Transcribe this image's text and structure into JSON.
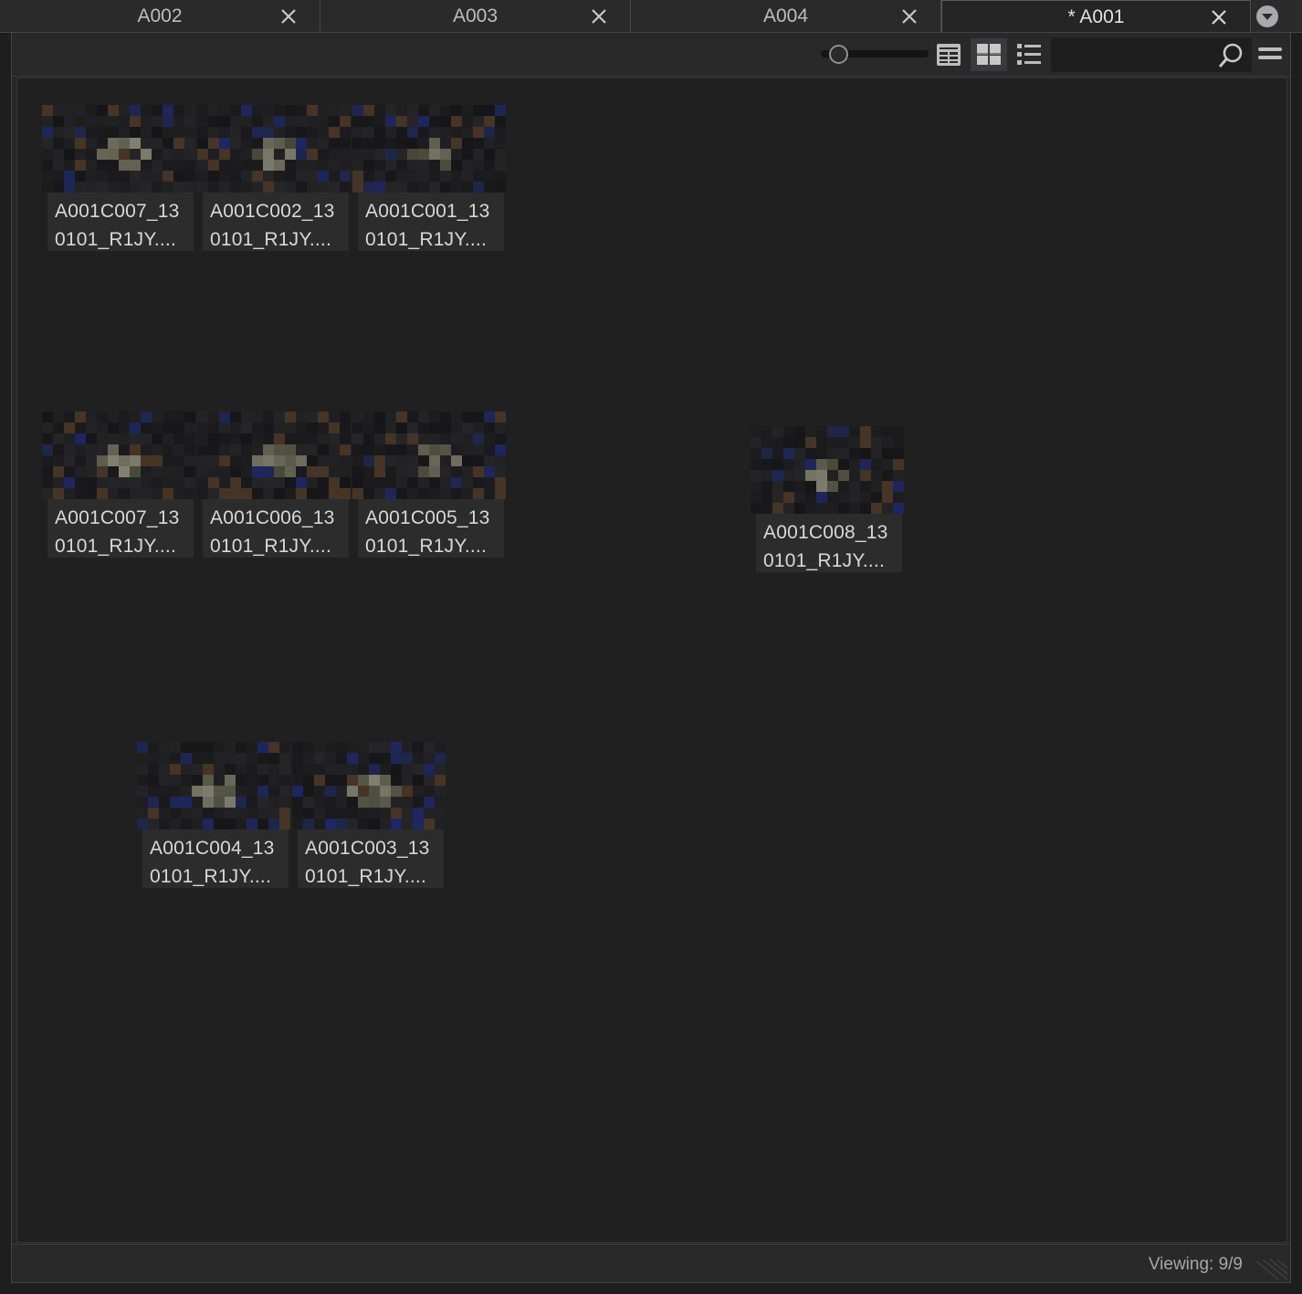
{
  "tabs": [
    {
      "label": "A002",
      "active": false
    },
    {
      "label": "A003",
      "active": false
    },
    {
      "label": "A004",
      "active": false
    },
    {
      "label": "* A001",
      "active": true
    }
  ],
  "toolbar": {
    "zoom_level": 0.1,
    "view_modes": [
      "metadata-view-icon",
      "thumbnail-view-icon",
      "list-view-icon"
    ],
    "active_view": "thumbnail-view-icon",
    "search_value": ""
  },
  "clips": [
    {
      "line1": "A001C007_13",
      "line2": "0101_R1JY...."
    },
    {
      "line1": "A001C002_13",
      "line2": "0101_R1JY...."
    },
    {
      "line1": "A001C001_13",
      "line2": "0101_R1JY...."
    },
    {
      "line1": "A001C007_13",
      "line2": "0101_R1JY...."
    },
    {
      "line1": "A001C006_13",
      "line2": "0101_R1JY...."
    },
    {
      "line1": "A001C005_13",
      "line2": "0101_R1JY...."
    },
    {
      "line1": "A001C008_13",
      "line2": "0101_R1JY...."
    },
    {
      "line1": "A001C004_13",
      "line2": "0101_R1JY...."
    },
    {
      "line1": "A001C003_13",
      "line2": "0101_R1JY...."
    }
  ],
  "status": {
    "viewing": "Viewing: 9/9"
  },
  "colors": {
    "background": "#1e1e1f",
    "panel": "#262627",
    "label_bg": "#2c2c2d",
    "text": "#d8d8d8"
  }
}
